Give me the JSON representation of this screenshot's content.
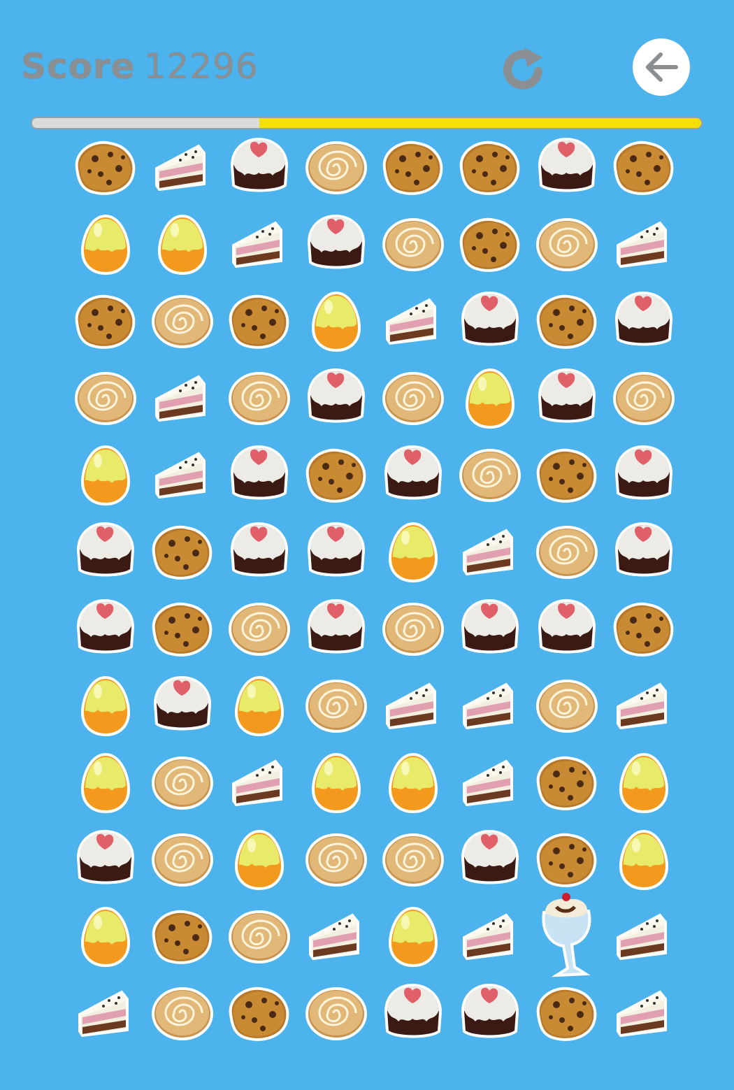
{
  "hud": {
    "score_label": "Score",
    "score_value": "12296",
    "restart_icon": "restart-icon",
    "back_icon": "back-arrow-icon"
  },
  "progress": {
    "fraction": 0.66,
    "fill_color": "#f5e000",
    "track_color": "#dcdcdc"
  },
  "colors": {
    "background": "#4db3ec",
    "score_text": "#8a8f94"
  },
  "board": {
    "rows": 12,
    "cols": 8,
    "cells": [
      [
        "cookie",
        "cake",
        "cupcake",
        "bun",
        "cookie",
        "cookie",
        "cupcake",
        "cookie"
      ],
      [
        "egg",
        "egg",
        "cake",
        "cupcake",
        "bun",
        "cookie",
        "bun",
        "cake"
      ],
      [
        "cookie",
        "bun",
        "cookie",
        "egg",
        "cake",
        "cupcake",
        "cookie",
        "cupcake"
      ],
      [
        "bun",
        "cake",
        "bun",
        "cupcake",
        "bun",
        "egg",
        "cupcake",
        "bun"
      ],
      [
        "egg",
        "cake",
        "cupcake",
        "cookie",
        "cupcake",
        "bun",
        "cookie",
        "cupcake"
      ],
      [
        "cupcake",
        "cookie",
        "cupcake",
        "cupcake",
        "egg",
        "cake",
        "bun",
        "cupcake"
      ],
      [
        "cupcake",
        "cookie",
        "bun",
        "cupcake",
        "bun",
        "cupcake",
        "cupcake",
        "cookie"
      ],
      [
        "egg",
        "cupcake",
        "egg",
        "bun",
        "cake",
        "cake",
        "bun",
        "cake"
      ],
      [
        "egg",
        "bun",
        "cake",
        "egg",
        "egg",
        "cake",
        "cookie",
        "egg"
      ],
      [
        "cupcake",
        "bun",
        "egg",
        "bun",
        "bun",
        "cupcake",
        "cookie",
        "egg"
      ],
      [
        "egg",
        "cookie",
        "bun",
        "cake",
        "egg",
        "cake",
        "sundae",
        "cake"
      ],
      [
        "cake",
        "bun",
        "cookie",
        "bun",
        "cupcake",
        "cupcake",
        "cookie",
        "cake"
      ]
    ]
  }
}
